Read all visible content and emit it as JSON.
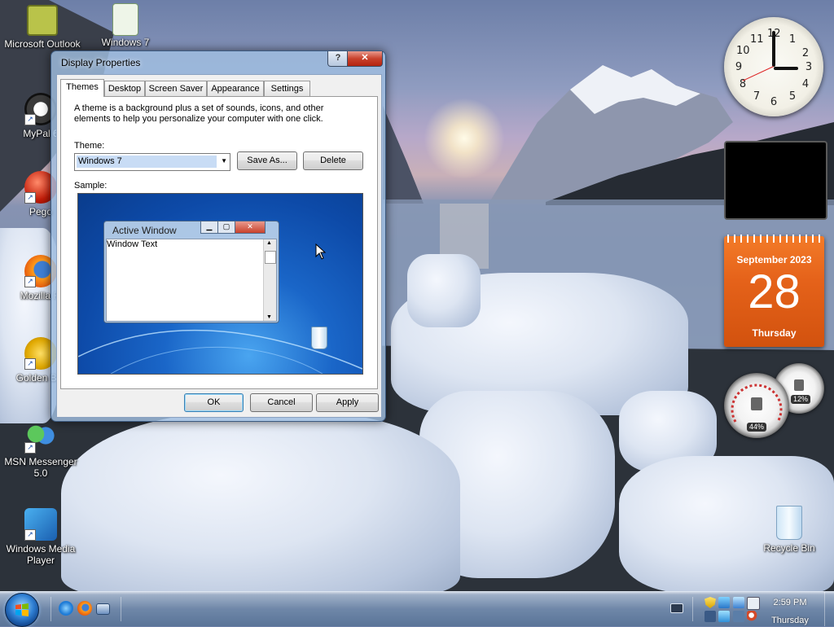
{
  "desktop": {
    "icons": [
      {
        "label": "Microsoft Outlook",
        "icon": "outlook-icon"
      },
      {
        "label": "Windows 7",
        "icon": "windows7-doc-icon"
      },
      {
        "label": "MyPal 6",
        "icon": "mypal-icon"
      },
      {
        "label": "Pego",
        "icon": "pego-icon"
      },
      {
        "label": "Mozilla Fi",
        "icon": "firefox-icon"
      },
      {
        "label": "Golden Bro",
        "icon": "golden-browser-icon"
      },
      {
        "label": "MSN Messenger 5.0",
        "icon": "msn-messenger-icon"
      },
      {
        "label": "Windows Media Player",
        "icon": "media-player-icon"
      },
      {
        "label": "Recycle Bin",
        "icon": "recycle-bin-icon"
      }
    ]
  },
  "dialog": {
    "title": "Display Properties",
    "help_label": "?",
    "close_label": "✕",
    "tabs": [
      {
        "label": "Themes",
        "active": true
      },
      {
        "label": "Desktop",
        "active": false
      },
      {
        "label": "Screen Saver",
        "active": false
      },
      {
        "label": "Appearance",
        "active": false
      },
      {
        "label": "Settings",
        "active": false
      }
    ],
    "description": "A theme is a background plus a set of sounds, icons, and other elements to help you personalize your computer with one click.",
    "theme_label": "Theme:",
    "theme_value": "Windows 7",
    "save_as_label": "Save As...",
    "delete_label": "Delete",
    "sample_label": "Sample:",
    "sample": {
      "window_title": "Active Window",
      "window_text": "Window Text"
    },
    "ok_label": "OK",
    "cancel_label": "Cancel",
    "apply_label": "Apply"
  },
  "gadgets": {
    "clock": {
      "numbers": [
        "12",
        "1",
        "2",
        "3",
        "4",
        "5",
        "6",
        "7",
        "8",
        "9",
        "10",
        "11"
      ],
      "time": "2:59"
    },
    "calendar": {
      "month_year": "September 2023",
      "day": "28",
      "weekday": "Thursday"
    },
    "cpu_meter": {
      "cpu": "44%",
      "memory": "12%"
    }
  },
  "taskbar": {
    "quick_launch": [
      "ie-icon",
      "firefox-icon",
      "show-desktop-icon"
    ],
    "clock_time": "2:59 PM",
    "clock_day": "Thursday"
  },
  "colors": {
    "calendar_orange": "#e5621a",
    "sample_blue": "#1a66c8",
    "close_red": "#c8412c"
  }
}
